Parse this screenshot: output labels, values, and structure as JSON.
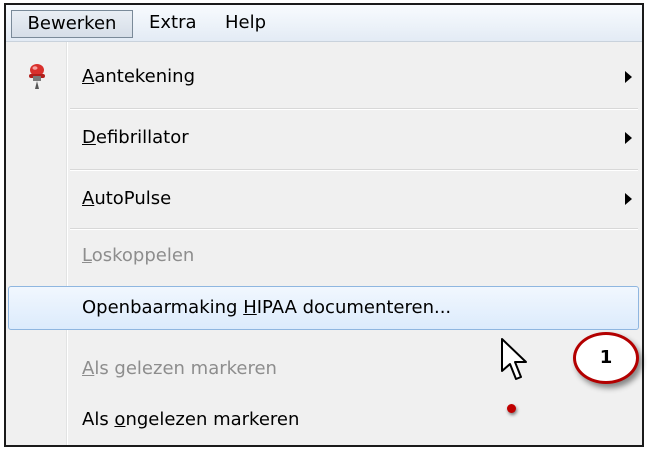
{
  "menubar": {
    "items": [
      {
        "label": "Bewerken",
        "open": true
      },
      {
        "label": "Extra"
      },
      {
        "label": "Help"
      }
    ]
  },
  "menu": {
    "items": [
      {
        "pre": "",
        "mn": "A",
        "post": "antekening",
        "icon": "pushpin-icon",
        "submenu": true,
        "enabled": true
      },
      {
        "pre": "",
        "mn": "D",
        "post": "efibrillator",
        "submenu": true,
        "enabled": true
      },
      {
        "pre": "",
        "mn": "A",
        "post": "utoPulse",
        "submenu": true,
        "enabled": true
      },
      {
        "pre": "",
        "mn": "L",
        "post": "oskoppelen",
        "submenu": false,
        "enabled": false
      },
      {
        "pre": "Openbaarmaking ",
        "mn": "H",
        "post": "IPAA documenteren...",
        "submenu": false,
        "enabled": true,
        "highlighted": true
      },
      {
        "pre": "",
        "mn": "A",
        "post": "ls gelezen markeren",
        "submenu": false,
        "enabled": false
      },
      {
        "pre": "Als ",
        "mn": "o",
        "post": "ngelezen markeren",
        "submenu": false,
        "enabled": true
      }
    ]
  },
  "annotation": {
    "callout_number": "1",
    "callout_color": "#b30000"
  },
  "colors": {
    "highlight_border": "#8fb6e0",
    "disabled_text": "#8d8d8d"
  }
}
